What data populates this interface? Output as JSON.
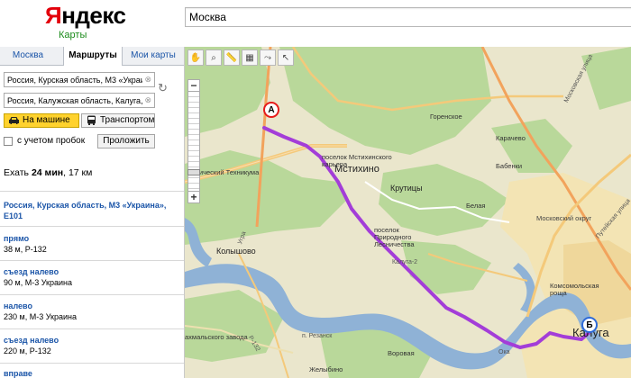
{
  "header": {
    "logo_text": "Яндекс",
    "logo_subtitle": "Карты",
    "search_value": "Москва"
  },
  "left_panel": {
    "tabs": [
      {
        "label": "Москва"
      },
      {
        "label": "Маршруты"
      },
      {
        "label": "Мои карты"
      }
    ],
    "route_points": [
      "Россия, Курская область, М3 «Украин",
      "Россия, Калужская область, Калуга, у"
    ],
    "modes": [
      {
        "label": "На машине",
        "icon": "car-icon"
      },
      {
        "label": "Транспортом",
        "icon": "bus-icon"
      }
    ],
    "traffic_label": "с учетом пробок",
    "extend_button": "Проложить",
    "summary_prefix": "Ехать ",
    "summary_time": "24 мин",
    "summary_distance": ", 17 км",
    "start_point": "Россия, Курская область, М3 «Украина», Е101",
    "steps": [
      {
        "title": "прямо",
        "detail": "38 м, Р-132"
      },
      {
        "title": "съезд налево",
        "detail": "90 м, М-3 Украина"
      },
      {
        "title": "налево",
        "detail": "230 м, М-3 Украина"
      },
      {
        "title": "съезд налево",
        "detail": "220 м, Р-132"
      },
      {
        "title": "вправе",
        "detail": ""
      }
    ]
  },
  "map": {
    "toolbar": [
      "hand-icon",
      "magnifier-icon",
      "ruler-icon",
      "layers-icon",
      "route-icon",
      "pointer-icon"
    ],
    "labels": {
      "texnikum": "хнический Техникума",
      "mstikhino": "Мстихино",
      "poselok_mst": "поселок Мстихинского карьера",
      "poselok_pr": "поселок Природного Лесничества",
      "krutitsy": "Крутицы",
      "gorenskoe": "Горенское",
      "karachevo": "Карачево",
      "babenki": "Бабенки",
      "belaya": "Белая",
      "kaluga2": "Калуга-2",
      "kolyshovo": "Колышово",
      "kaluga": "Калуга",
      "moscow_street": "Московская улица",
      "putevskaya": "Путейская улица",
      "moskovsky": "Московский округ",
      "komsomolskaya": "Комсомольская роща",
      "vorovaya": "Воровая",
      "zhelybino": "Желыбино",
      "pos_rezansk": "п. Резанск",
      "zavod": "ахмальского завода",
      "oka": "Ока",
      "ugra": "Угра",
      "r132": "Р-132"
    },
    "pin_a": "А",
    "pin_b": "Б"
  },
  "colors": {
    "route": "#a33dd8",
    "accent_yellow": "#ffd22e",
    "link_blue": "#1b55a8",
    "water": "#8fb2d6",
    "forest": "#b9d89a"
  }
}
